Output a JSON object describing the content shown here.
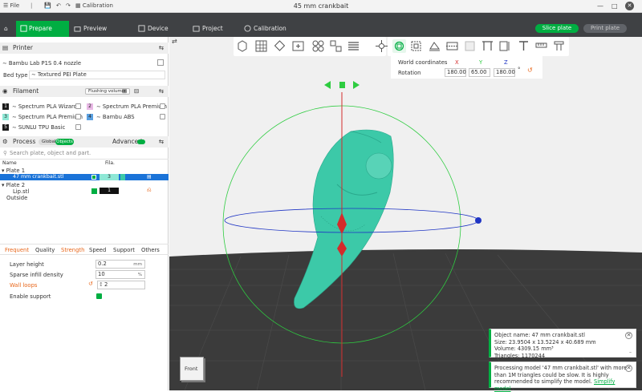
{
  "window": {
    "title": "45 mm crankbait"
  },
  "titlebar": {
    "file": "File",
    "calibration": "Calibration"
  },
  "tabs": [
    {
      "label": "Prepare"
    },
    {
      "label": "Preview"
    },
    {
      "label": "Device"
    },
    {
      "label": "Project"
    },
    {
      "label": "Calibration"
    }
  ],
  "actions": {
    "slice": "Slice plate",
    "print": "Print plate"
  },
  "printer": {
    "section": "Printer",
    "name": "Bambu Lab P1S 0.4 nozzle",
    "bed_type_label": "Bed type",
    "bed_type": "Textured PEI Plate"
  },
  "filament": {
    "section": "Filament",
    "flushing": "Flushing volumes",
    "items": [
      {
        "num": "1",
        "name": "Spectrum PLA Wizard",
        "color": "#1a1a1a"
      },
      {
        "num": "2",
        "name": "Spectrum PLA Premium",
        "color": "#e9b9e6"
      },
      {
        "num": "3",
        "name": "Spectrum PLA Premium",
        "color": "#8ee8d6"
      },
      {
        "num": "4",
        "name": "Bambu ABS",
        "color": "#5aa0e0"
      },
      {
        "num": "5",
        "name": "SUNLU TPU Basic",
        "color": "#1a1a1a"
      }
    ]
  },
  "process": {
    "section": "Process",
    "toggle_global": "Global",
    "toggle_objects": "Objects",
    "advanced": "Advanced",
    "search_placeholder": "Search plate, object and part.",
    "col_name": "Name",
    "col_fila": "Fila.",
    "tree": {
      "plate1": "Plate 1",
      "obj1": "47 mm crankbait.stl",
      "obj1_fila": "3",
      "plate2": "Plate 2",
      "obj2": "Lip.stl",
      "obj2_fila": "1",
      "outside": "Outside"
    }
  },
  "settings_tabs": [
    "Frequent",
    "Quality",
    "Strength",
    "Speed",
    "Support",
    "Others"
  ],
  "settings": {
    "layer_height": {
      "label": "Layer height",
      "value": "0.2",
      "unit": "mm"
    },
    "sparse_infill": {
      "label": "Sparse infill density",
      "value": "10",
      "unit": "%"
    },
    "wall_loops": {
      "label": "Wall loops",
      "value": "2"
    },
    "enable_support": {
      "label": "Enable support"
    }
  },
  "coords": {
    "world_label": "World coordinates",
    "x": "X",
    "y": "Y",
    "z": "Z",
    "rotation_label": "Rotation",
    "rx": "180.00",
    "ry": "65.00",
    "rz": "180.00",
    "unit": "°"
  },
  "view": {
    "front_label": "Front"
  },
  "notifications": {
    "info": {
      "name": "Object name: 47 mm crankbait.stl",
      "size": "Size: 23.9504 x 13.5224 x 40.689 mm",
      "volume": "Volume: 4309.15 mm³",
      "triangles": "Triangles: 1170244"
    },
    "warning": {
      "text": "Processing model '47 mm crankbait.stl' with more than 1M triangles could be slow. It is highly recommended to simplify the model.",
      "link": "Simplify model"
    }
  },
  "colors": {
    "accent": "#00ae42",
    "dark_tabbar": "#3f4144",
    "model": "#3cc9a8",
    "x_axis": "#d42b2b",
    "y_axis": "#2ecc40",
    "z_axis": "#1f35c4"
  }
}
